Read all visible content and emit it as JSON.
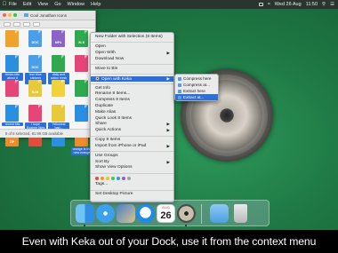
{
  "menubar": {
    "items": [
      "File",
      "Edit",
      "View",
      "Go",
      "Window",
      "Help"
    ],
    "datetime": "Wed 26 Aug",
    "time": "11:50"
  },
  "finder": {
    "title": "Cool Jonathan Icons",
    "status": "8 of 8 selected, 81.99 GB available",
    "files": [
      {
        "label": "",
        "color": "#f0a32a",
        "tag": ""
      },
      {
        "label": "",
        "color": "#4aa0e8",
        "tag": "DOC"
      },
      {
        "label": "",
        "color": "#8c63c8",
        "tag": "MP4"
      },
      {
        "label": "",
        "color": "#2fa84f",
        "tag": "XLS"
      },
      {
        "label": "thinks bits about it",
        "color": "#2b8fe0",
        "tag": ""
      },
      {
        "label": "box blue stickers labels all",
        "color": "#4aa0e8",
        "tag": "DOC"
      },
      {
        "label": "daily and action fresh green ...",
        "color": "#2fa84f",
        "tag": ""
      },
      {
        "label": "",
        "color": "#e6457a",
        "tag": ""
      },
      {
        "label": "",
        "color": "#e6457a",
        "tag": ""
      },
      {
        "label": "",
        "color": "#e8c93a",
        "tag": "RAR"
      },
      {
        "label": "",
        "color": "#f0d23a",
        "tag": ""
      },
      {
        "label": "",
        "color": "#2fa84f",
        "tag": ""
      },
      {
        "label": "recent bits",
        "color": "#2b8fe0",
        "tag": ""
      },
      {
        "label": "I hope Eugene likes puzzles ...",
        "color": "#e6457a",
        "tag": ""
      },
      {
        "label": "Yellowest bag...",
        "color": "#e8c93a",
        "tag": ""
      },
      {
        "label": "",
        "color": "#2b8fe0",
        "tag": ""
      },
      {
        "label": "",
        "color": "#f08a2a",
        "tag": "ZIP"
      },
      {
        "label": "",
        "color": "#e34b3a",
        "tag": ""
      },
      {
        "label": "",
        "color": "#2b8fe0",
        "tag": ""
      },
      {
        "label": "orange is the new orange",
        "color": "#f08a2a",
        "tag": ""
      }
    ]
  },
  "context_menu": {
    "items": [
      {
        "type": "item",
        "label": "New Folder with Selection (8 Items)"
      },
      {
        "type": "sep"
      },
      {
        "type": "item",
        "label": "Open"
      },
      {
        "type": "item",
        "label": "Open With",
        "submenu": true
      },
      {
        "type": "item",
        "label": "Download Now"
      },
      {
        "type": "sep"
      },
      {
        "type": "item",
        "label": "Move to Bin"
      },
      {
        "type": "sep"
      },
      {
        "type": "item",
        "label": "Open with Keka",
        "submenu": true,
        "highlighted": true,
        "icon": "keka-icon"
      },
      {
        "type": "sep"
      },
      {
        "type": "item",
        "label": "Get Info"
      },
      {
        "type": "item",
        "label": "Rename 8 Items..."
      },
      {
        "type": "item",
        "label": "Compress 8 Items"
      },
      {
        "type": "item",
        "label": "Duplicate"
      },
      {
        "type": "item",
        "label": "Make Alias"
      },
      {
        "type": "item",
        "label": "Quick Look 8 Items"
      },
      {
        "type": "item",
        "label": "Share",
        "submenu": true
      },
      {
        "type": "item",
        "label": "Quick Actions",
        "submenu": true
      },
      {
        "type": "sep"
      },
      {
        "type": "item",
        "label": "Copy 8 Items"
      },
      {
        "type": "item",
        "label": "Import from iPhone or iPad",
        "submenu": true
      },
      {
        "type": "sep"
      },
      {
        "type": "item",
        "label": "Use Groups"
      },
      {
        "type": "item",
        "label": "Sort By",
        "submenu": true
      },
      {
        "type": "item",
        "label": "Show View Options"
      },
      {
        "type": "sep"
      },
      {
        "type": "tags"
      },
      {
        "type": "item",
        "label": "Tags..."
      },
      {
        "type": "sep"
      },
      {
        "type": "item",
        "label": "Set Desktop Picture"
      }
    ],
    "tag_colors": [
      "#e84c3d",
      "#f39c12",
      "#f1c40f",
      "#2ecc71",
      "#3498db",
      "#9b59b6",
      "#95a5a6"
    ]
  },
  "submenu": {
    "items": [
      {
        "label": "Compress here",
        "highlighted": false
      },
      {
        "label": "Compress at...",
        "highlighted": false
      },
      {
        "label": "Extract here",
        "highlighted": false
      },
      {
        "label": "Extract at...",
        "highlighted": true
      }
    ]
  },
  "dock": {
    "apps": [
      "finder-icon",
      "safari-icon",
      "preview-icon",
      "messages-icon",
      "calendar-icon",
      "keka-icon",
      "downloads-icon",
      "trash-icon"
    ],
    "calendar": {
      "month": "AUG",
      "day": "26"
    }
  },
  "caption": "Even with Keka out of your Dock, use it from the context menu"
}
